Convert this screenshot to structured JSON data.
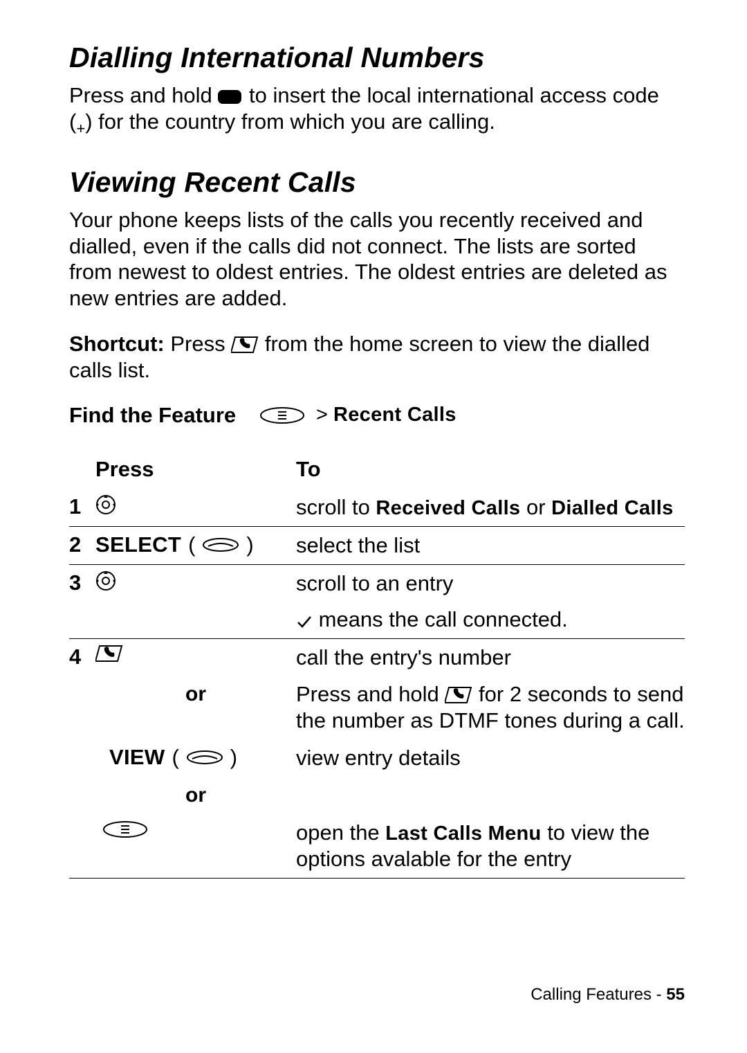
{
  "section1": {
    "heading": "Dialling International Numbers",
    "para_prefix": "Press and hold ",
    "para_suffix_a": " to insert the local international access code (",
    "plus": "+",
    "para_suffix_b": ") for the country from which you are calling."
  },
  "section2": {
    "heading": "Viewing Recent Calls",
    "para1": "Your phone keeps lists of the calls you recently received and dialled, even if the calls did not connect. The lists are sorted from newest to oldest entries. The oldest entries are deleted as new entries are added.",
    "shortcut_label": "Shortcut:",
    "shortcut_prefix": " Press ",
    "shortcut_suffix": " from the home screen to view the dialled calls list.",
    "feature_label": "Find the Feature",
    "feature_breadcrumb_prefix": "> ",
    "feature_breadcrumb": "Recent Calls",
    "table": {
      "head_press": "Press",
      "head_to": "To",
      "rows": {
        "r1": {
          "num": "1",
          "to_a": "scroll to ",
          "to_b": "Received Calls",
          "to_c": " or ",
          "to_d": "Dialled Calls"
        },
        "r2": {
          "num": "2",
          "press_label": "SELECT",
          "to": "select the list"
        },
        "r3": {
          "num": "3",
          "to_a": "scroll to an entry",
          "to_b": " means the call connected."
        },
        "r4": {
          "num": "4",
          "to_a": "call the entry's number",
          "to_b_pre": "Press and hold ",
          "to_b_post": " for 2 seconds to send the number as DTMF tones during a call.",
          "or": "or",
          "view_label": "VIEW",
          "to_view": "view entry details",
          "to_menu_a": "open the ",
          "to_menu_b": "Last Calls Menu",
          "to_menu_c": " to view the options avalable for the entry"
        }
      }
    }
  },
  "footer": {
    "section": "Calling Features",
    "sep": " - ",
    "page": "55"
  }
}
